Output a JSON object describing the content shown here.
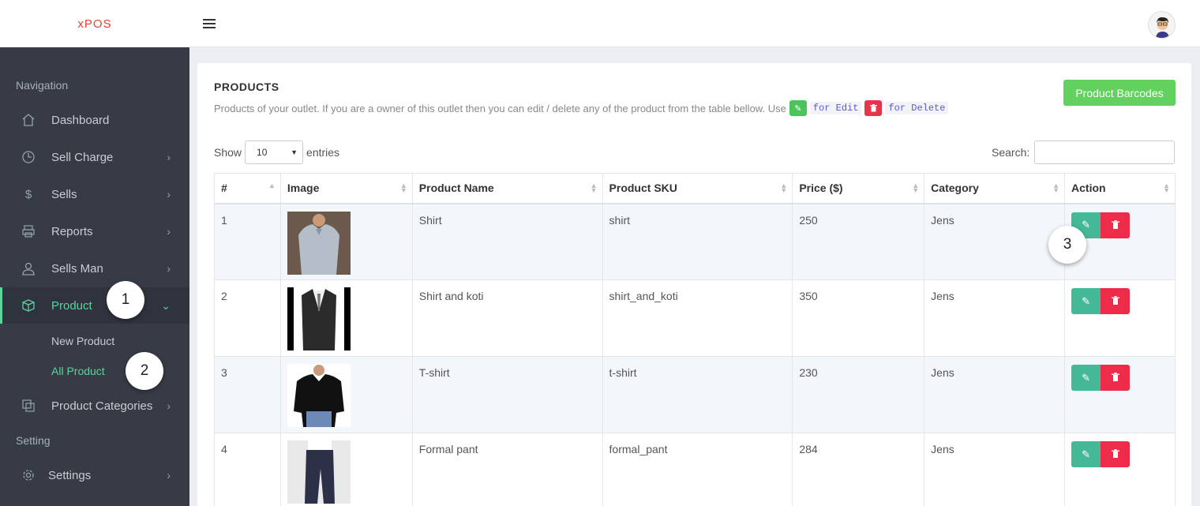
{
  "app": {
    "logo": "xPOS"
  },
  "sidebar": {
    "nav_heading": "Navigation",
    "setting_heading": "Setting",
    "items": [
      {
        "label": "Dashboard",
        "icon": "home-icon"
      },
      {
        "label": "Sell Charge",
        "icon": "clock-icon"
      },
      {
        "label": "Sells",
        "icon": "dollar-icon"
      },
      {
        "label": "Reports",
        "icon": "printer-icon"
      },
      {
        "label": "Sells Man",
        "icon": "user-icon"
      },
      {
        "label": "Product",
        "icon": "box-icon"
      },
      {
        "label": "Product Categories",
        "icon": "layers-icon"
      },
      {
        "label": "Settings",
        "icon": "gear-icon"
      }
    ],
    "sub_items": [
      {
        "label": "New Product"
      },
      {
        "label": "All Product"
      }
    ]
  },
  "callouts": [
    "1",
    "2",
    "3"
  ],
  "page": {
    "title": "PRODUCTS",
    "desc_prefix": "Products of your outlet. If you are a owner of this outlet then you can edit / delete any of the product from the table bellow. Use",
    "edit_hint": "for Edit",
    "delete_hint": "for Delete",
    "barcode_button": "Product Barcodes",
    "show_label": "Show",
    "entries_value": "10",
    "entries_label": "entries",
    "search_label": "Search:"
  },
  "table": {
    "headers": [
      "#",
      "Image",
      "Product Name",
      "Product SKU",
      "Price ($)",
      "Category",
      "Action"
    ],
    "rows": [
      {
        "num": "1",
        "name": "Shirt",
        "sku": "shirt",
        "price": "250",
        "category": "Jens",
        "image": "shirt"
      },
      {
        "num": "2",
        "name": "Shirt and koti",
        "sku": "shirt_and_koti",
        "price": "350",
        "category": "Jens",
        "image": "vest"
      },
      {
        "num": "3",
        "name": "T-shirt",
        "sku": "t-shirt",
        "price": "230",
        "category": "Jens",
        "image": "sweater"
      },
      {
        "num": "4",
        "name": "Formal pant",
        "sku": "formal_pant",
        "price": "284",
        "category": "Jens",
        "image": "pant"
      }
    ]
  },
  "colors": {
    "accent": "#5dd39e",
    "sidebar": "#363b46",
    "edit": "#44b897",
    "delete": "#ee2b48",
    "barcode": "#62d15d"
  }
}
